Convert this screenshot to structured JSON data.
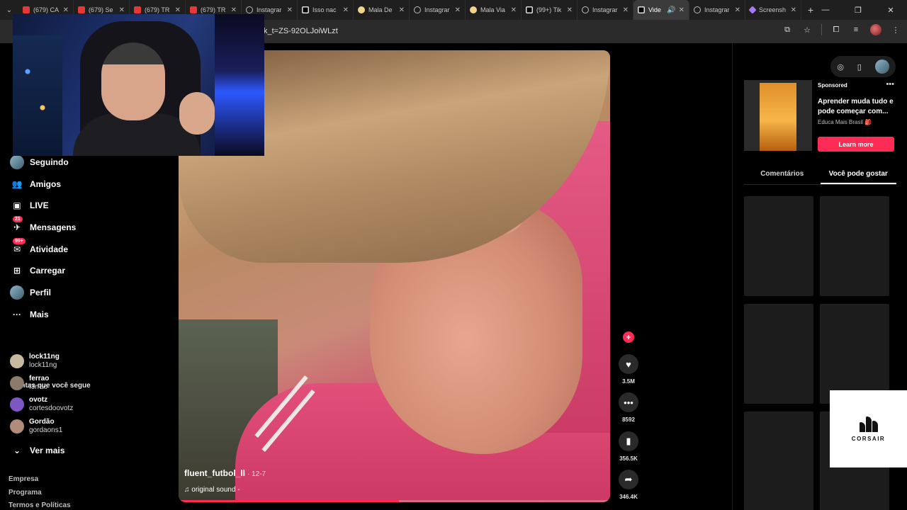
{
  "browser": {
    "tabs": [
      {
        "title": "(679) CA",
        "icon": "youtube",
        "active": false,
        "w": 78
      },
      {
        "title": "(679) Se",
        "icon": "youtube",
        "active": false,
        "w": 79
      },
      {
        "title": "(679) TR",
        "icon": "youtube",
        "active": false,
        "w": 79
      },
      {
        "title": "(679) TR",
        "icon": "youtube",
        "active": false,
        "w": 79
      },
      {
        "title": "Instagrar",
        "icon": "web",
        "active": false,
        "w": 79
      },
      {
        "title": "Isso nac",
        "icon": "tiktok",
        "active": false,
        "w": 79
      },
      {
        "title": "Mala De",
        "icon": "mala",
        "active": false,
        "w": 79
      },
      {
        "title": "Instagrar",
        "icon": "web",
        "active": false,
        "w": 79
      },
      {
        "title": "Mala Via",
        "icon": "mala",
        "active": false,
        "w": 79
      },
      {
        "title": "(99+) Tik",
        "icon": "tiktok",
        "active": false,
        "w": 79
      },
      {
        "title": "Instagrar",
        "icon": "web",
        "active": false,
        "w": 79
      },
      {
        "title": "Vide",
        "icon": "tiktok",
        "active": true,
        "w": 79
      },
      {
        "title": "Instagrar",
        "icon": "web",
        "active": false,
        "w": 79
      },
      {
        "title": "Screensh",
        "icon": "shot",
        "active": false,
        "w": 79
      }
    ],
    "url": "k_t=ZS-92OLJoiWLzt"
  },
  "nav": {
    "items": [
      {
        "label": "Seguindo",
        "icon": "avatar",
        "name": "nav-seguindo"
      },
      {
        "label": "Amigos",
        "icon": "friends",
        "name": "nav-amigos"
      },
      {
        "label": "LIVE",
        "icon": "live",
        "name": "nav-live"
      },
      {
        "label": "Mensagens",
        "icon": "messages",
        "badge": "21",
        "name": "nav-mensagens"
      },
      {
        "label": "Atividade",
        "icon": "activity",
        "badge": "99+",
        "name": "nav-atividade"
      },
      {
        "label": "Carregar",
        "icon": "upload",
        "name": "nav-carregar"
      },
      {
        "label": "Perfil",
        "icon": "avatar",
        "name": "nav-perfil"
      },
      {
        "label": "Mais",
        "icon": "more",
        "name": "nav-mais"
      }
    ],
    "following_title": "Contas que você segue",
    "following": [
      {
        "name": "lock11ng",
        "username": "lock11ng",
        "color": "#c9b8a0"
      },
      {
        "name": "ferrao",
        "username": "f3rrao",
        "color": "#8c7a6b"
      },
      {
        "name": "ovotz",
        "username": "cortesdoovotz",
        "color": "#7e57c2"
      },
      {
        "name": "Gordão",
        "username": "gordaons1",
        "color": "#b08d7a"
      }
    ],
    "see_more": "Ver mais",
    "footer": [
      "Empresa",
      "Programa",
      "Termos e Políticas"
    ]
  },
  "video": {
    "author": "fluent_futbol_ll",
    "date": "· 12-7",
    "sound": "original sound -",
    "progress": 0.51
  },
  "actions": {
    "likes": "3.5M",
    "comments": "8592",
    "saves": "356.5K",
    "shares": "346.4K"
  },
  "sidebar_right": {
    "ad": {
      "sponsored": "Sponsored",
      "title": "Aprender muda tudo e pode começar com...",
      "brand": "Educa Mais Brasil 🎒",
      "cta": "Learn more"
    },
    "tabs": [
      "Comentários",
      "Você pode gostar"
    ],
    "active_tab": 1
  },
  "overlay": {
    "brand": "CORSAIR"
  }
}
